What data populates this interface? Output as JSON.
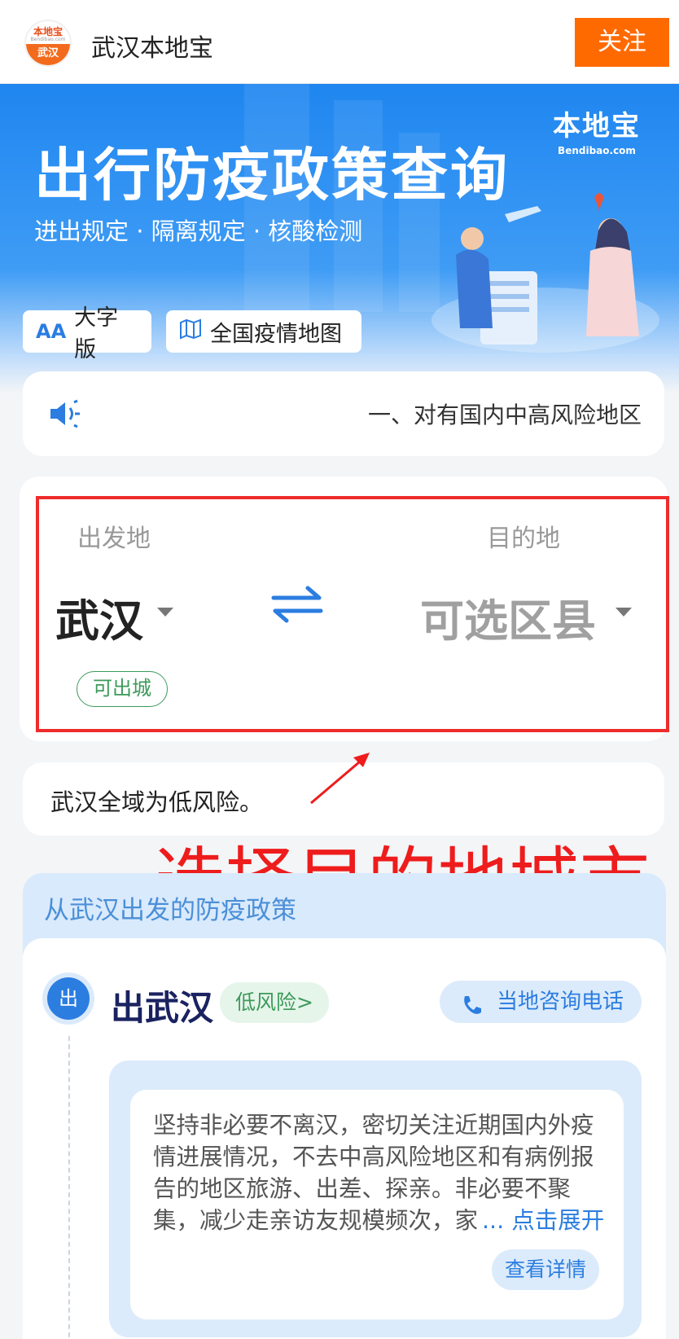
{
  "header": {
    "logo_top": "本地宝",
    "logo_sub": "Bendibao.com",
    "logo_city": "武汉",
    "title": "武汉本地宝",
    "follow_label": "关注"
  },
  "banner": {
    "brand": "本地宝",
    "brand_sub": "Bendibao.com",
    "title": "出行防疫政策查询",
    "subtitle": "进出规定 · 隔离规定 · 核酸检测",
    "large_text_label": "大字版",
    "large_text_icon": "AA",
    "map_label": "全国疫情地图"
  },
  "notice": {
    "text": "一、对有国内中高风险地区"
  },
  "route": {
    "from_label": "出发地",
    "to_label": "目的地",
    "from_city": "武汉",
    "to_city": "可选区县",
    "status": "可出城"
  },
  "risk_summary": "武汉全域为低风险。",
  "annotation": "选择目的地城市",
  "policy": {
    "header": "从武汉出发的防疫政策",
    "badge": "出",
    "title": "出武汉",
    "risk_tag": "低风险>",
    "hotline_label": "当地咨询电话",
    "detail": "坚持非必要不离汉，密切关注近期国内外疫情进展情况，不去中高风险地区和有病例报告的地区旅游、出差、探亲。非必要不聚集，减少走亲访友规模频次，家",
    "expand_label": "... 点击展开",
    "view_detail_label": "查看详情"
  },
  "colors": {
    "accent": "#ff6a00",
    "primary_blue": "#2b7de0",
    "annotation_red": "#ee1c1c",
    "low_risk_green": "#3d9a5a"
  }
}
